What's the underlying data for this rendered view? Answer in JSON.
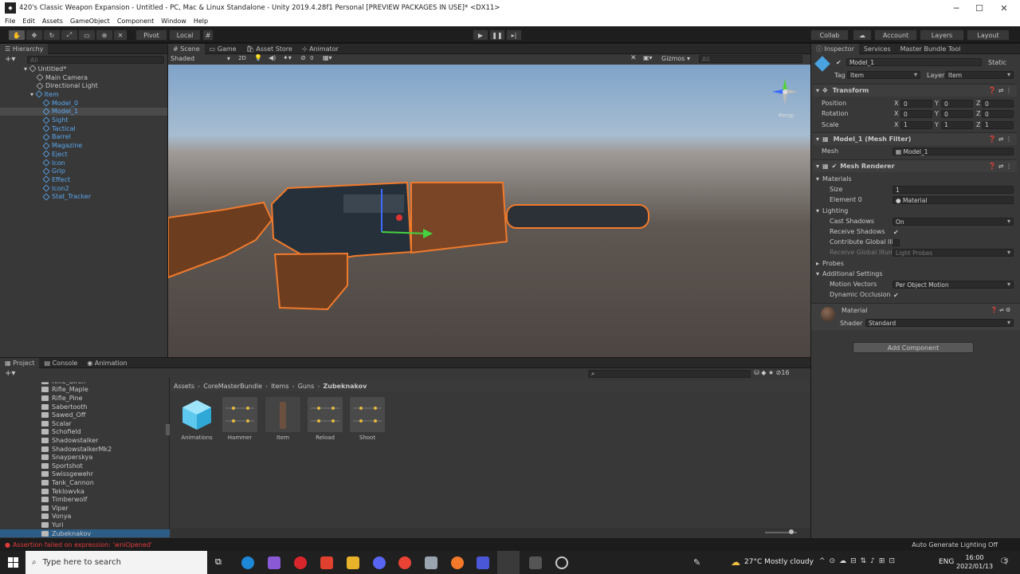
{
  "window": {
    "title": "420's Classic Weapon Expansion - Untitled - PC, Mac & Linux Standalone - Unity 2019.4.28f1 Personal [PREVIEW PACKAGES IN USE]* <DX11>",
    "icon": "unity-icon"
  },
  "menu": [
    "File",
    "Edit",
    "Assets",
    "GameObject",
    "Component",
    "Window",
    "Help"
  ],
  "toolbar": {
    "pivot": "Pivot",
    "local": "Local",
    "collab": "Collab",
    "account": "Account",
    "layers": "Layers",
    "layout": "Layout"
  },
  "hierarchy": {
    "tab": "Hierarchy",
    "search_placeholder": "All",
    "scene": "Untitled*",
    "items": [
      "Main Camera",
      "Directional Light",
      "Item"
    ],
    "children": [
      "Model_0",
      "Model_1",
      "Sight",
      "Tactical",
      "Barrel",
      "Magazine",
      "Eject",
      "Icon",
      "Grip",
      "Effect",
      "Icon2",
      "Stat_Tracker"
    ]
  },
  "scene": {
    "tabs": [
      "Scene",
      "Game",
      "Asset Store",
      "Animator"
    ],
    "shading": "Shaded",
    "mode_2d": "2D",
    "gizmos": "Gizmos",
    "search_placeholder": "All",
    "persp": "Persp",
    "hidden_count": "0"
  },
  "inspector": {
    "tabs": [
      "Inspector",
      "Services",
      "Master Bundle Tool"
    ],
    "object_name": "Model_1",
    "static": "Static",
    "tag_label": "Tag",
    "tag": "Item",
    "layer_label": "Layer",
    "layer": "Item",
    "transform": {
      "title": "Transform",
      "rows": [
        {
          "label": "Position",
          "x": "0",
          "y": "0",
          "z": "0"
        },
        {
          "label": "Rotation",
          "x": "0",
          "y": "0",
          "z": "0"
        },
        {
          "label": "Scale",
          "x": "1",
          "y": "1",
          "z": "1"
        }
      ]
    },
    "mesh_filter": {
      "title": "Model_1 (Mesh Filter)",
      "mesh_label": "Mesh",
      "mesh": "Model_1"
    },
    "mesh_renderer": {
      "title": "Mesh Renderer",
      "materials": "Materials",
      "size_label": "Size",
      "size": "1",
      "element_label": "Element 0",
      "element": "Material",
      "lighting": "Lighting",
      "cast_label": "Cast Shadows",
      "cast": "On",
      "receive_label": "Receive Shadows",
      "contribute_label": "Contribute Global Illu",
      "receive_gi_label": "Receive Global Illumi",
      "receive_gi": "Light Probes",
      "probes": "Probes",
      "additional": "Additional Settings",
      "motion_label": "Motion Vectors",
      "motion": "Per Object Motion",
      "occlusion_label": "Dynamic Occlusion"
    },
    "material": {
      "name": "Material",
      "shader_label": "Shader",
      "shader": "Standard"
    },
    "add_component": "Add Component"
  },
  "bottom": {
    "tabs": [
      "Project",
      "Console",
      "Animation"
    ],
    "folders": [
      "Rifle_Birch",
      "Rifle_Maple",
      "Rifle_Pine",
      "Sabertooth",
      "Sawed_Off",
      "Scalar",
      "Schofield",
      "Shadowstalker",
      "ShadowstalkerMk2",
      "Snayperskya",
      "Sportshot",
      "Swissgewehr",
      "Tank_Cannon",
      "Teklowvka",
      "Timberwolf",
      "Viper",
      "Vonya",
      "Yuri",
      "Zubeknakov"
    ],
    "breadcrumb": [
      "Assets",
      "CoreMasterBundle",
      "Items",
      "Guns",
      "Zubeknakov"
    ],
    "assets": [
      "Animations",
      "Hammer",
      "Item",
      "Reload",
      "Shoot"
    ],
    "layer_count": "16",
    "search_placeholder": ""
  },
  "status": {
    "error": "Assertion failed on expression: 'wniOpened'",
    "right": "Auto Generate Lighting Off"
  },
  "taskbar": {
    "search": "Type here to search",
    "weather": "27°C  Mostly cloudy",
    "lang": "ENG",
    "time": "16:00",
    "date": "2022/01/13",
    "notif": "5"
  },
  "colors": {
    "accent": "#3d7ad6",
    "orange": "#f07a2c",
    "error": "#e03c3c"
  }
}
